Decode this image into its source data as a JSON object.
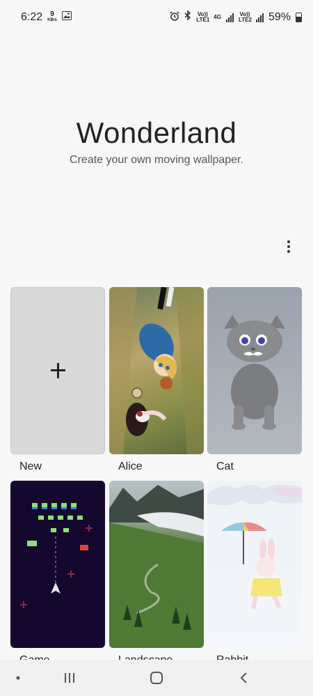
{
  "status_bar": {
    "time": "6:22",
    "net_speed_value": "9",
    "net_speed_unit": "KB/s",
    "volte1": "Vo)) LTE1",
    "network_4g": "4G",
    "volte2": "Vo)) LTE2",
    "battery_percent": "59%",
    "battery_level": 0.59,
    "icons": [
      "gallery-icon",
      "alarm-icon",
      "bluetooth-icon",
      "signal-icon",
      "battery-icon"
    ]
  },
  "hero": {
    "title": "Wonderland",
    "subtitle": "Create your own moving wallpaper."
  },
  "menu": {
    "icon": "more-vert-icon"
  },
  "wallpapers": [
    {
      "label": "New",
      "type": "add"
    },
    {
      "label": "Alice",
      "type": "preset"
    },
    {
      "label": "Cat",
      "type": "preset"
    },
    {
      "label": "Game",
      "type": "preset"
    },
    {
      "label": "Landscape",
      "type": "preset"
    },
    {
      "label": "Rabbit",
      "type": "preset"
    }
  ],
  "nav": {
    "icons": [
      "dot-icon",
      "recent-apps-icon",
      "home-icon",
      "back-icon"
    ]
  }
}
